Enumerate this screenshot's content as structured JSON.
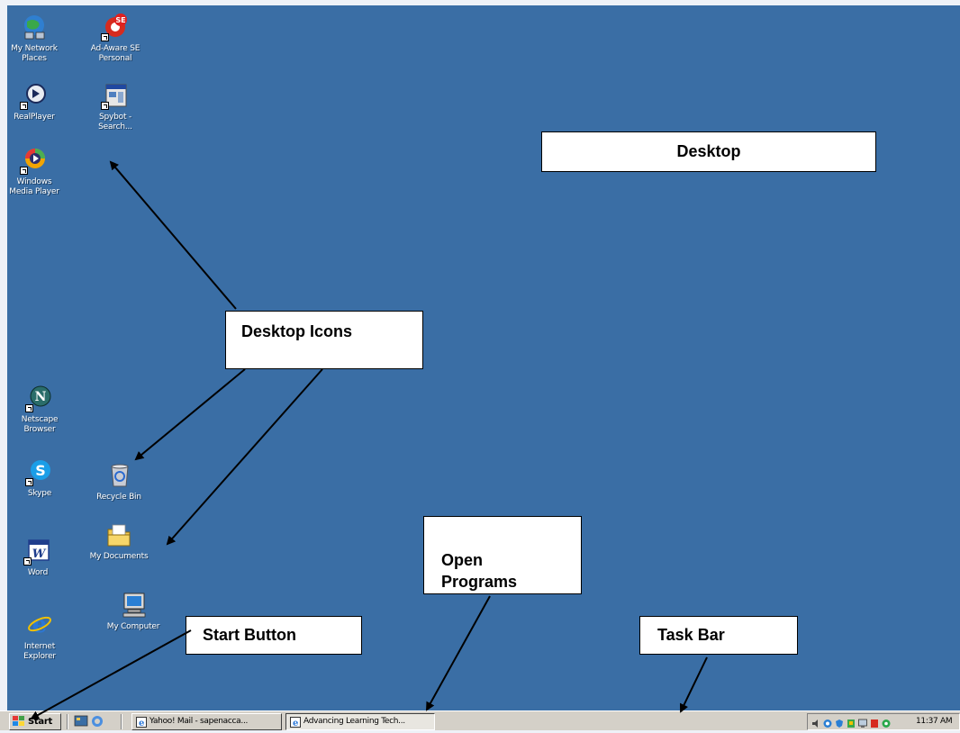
{
  "desktop_icons": {
    "network_places": "My Network\nPlaces",
    "adaware": "Ad-Aware SE\nPersonal",
    "realplayer": "RealPlayer",
    "spybot": "Spybot -\nSearch...",
    "media_player": "Windows\nMedia Player",
    "netscape": "Netscape\nBrowser",
    "skype": "Skype",
    "recycle_bin": "Recycle Bin",
    "my_documents": "My Documents",
    "word": "Word",
    "my_computer": "My Computer",
    "internet_explorer": "Internet\nExplorer"
  },
  "callouts": {
    "desktop": "Desktop",
    "desktop_icons": "Desktop Icons",
    "open_programs": "Open\nPrograms",
    "start_button": "Start Button",
    "task_bar": "Task Bar"
  },
  "taskbar": {
    "start_label": "Start",
    "task1": "Yahoo! Mail - sapenacca...",
    "task2": "Advancing Learning Tech...",
    "clock": "11:37 AM"
  },
  "colors": {
    "desktop_bg": "#3a6ea5",
    "taskbar_bg": "#d4d0c8"
  }
}
